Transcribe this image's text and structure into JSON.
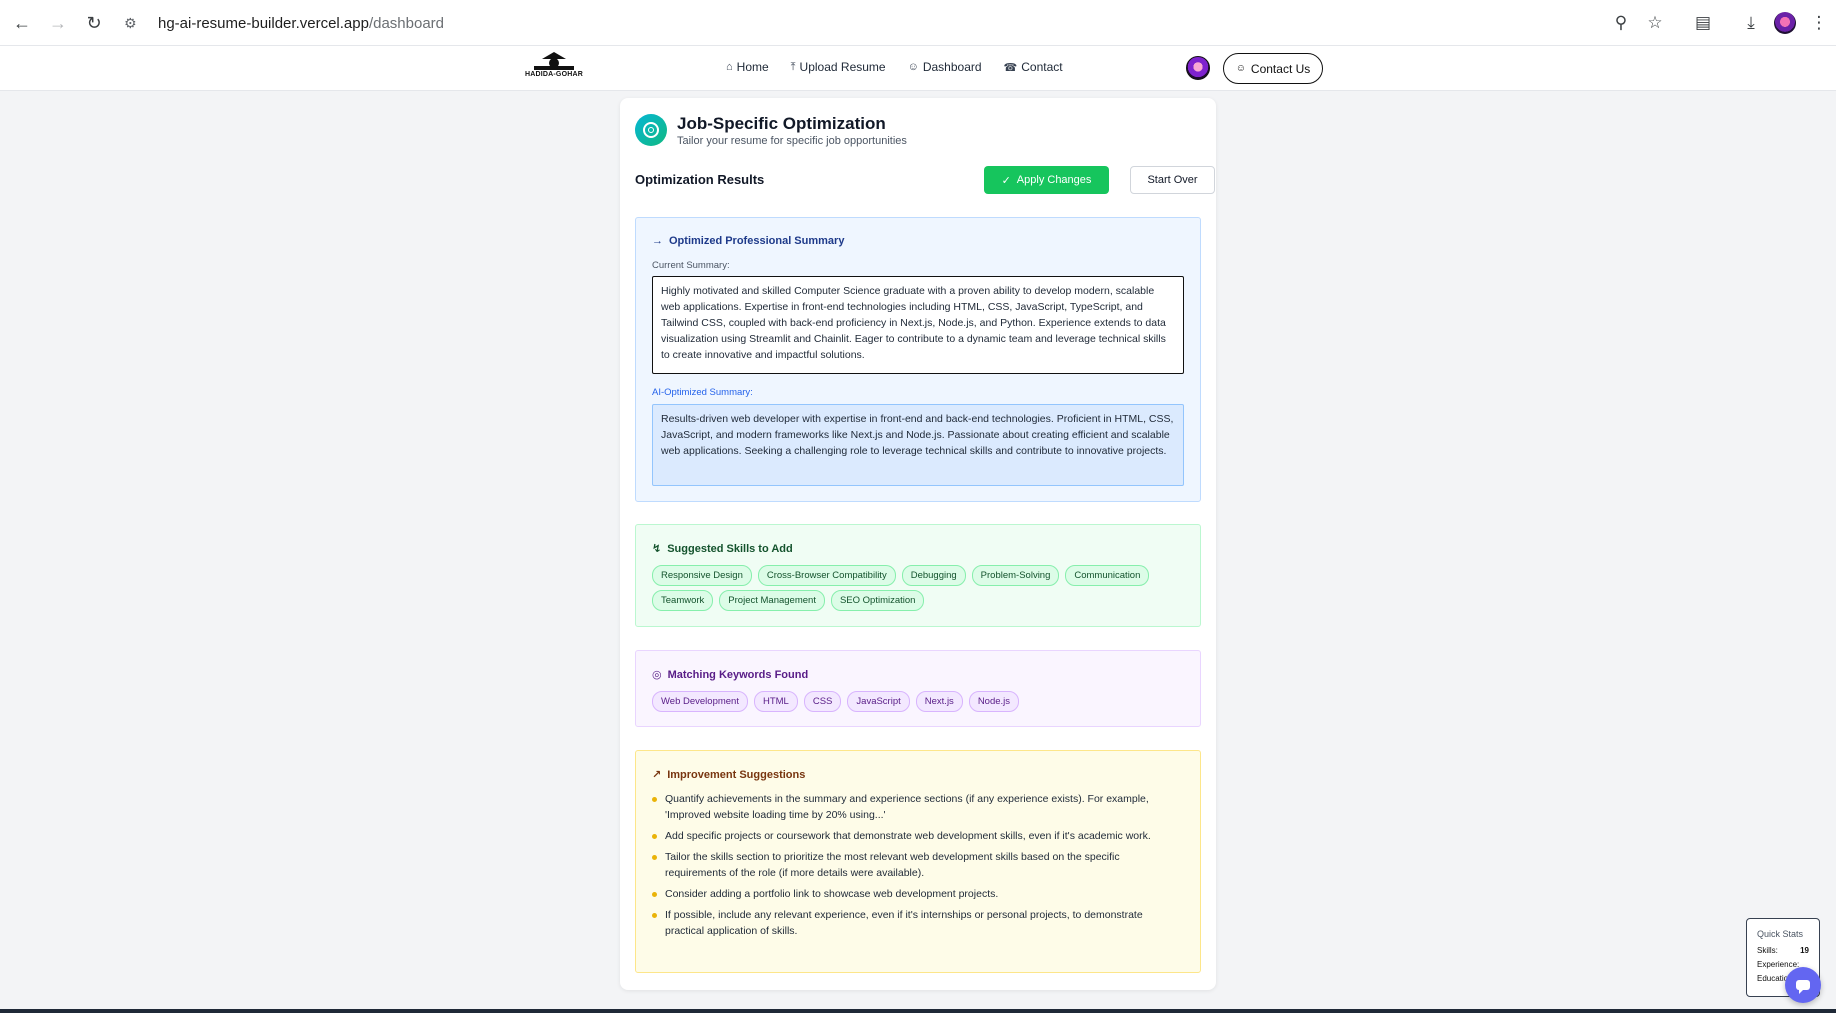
{
  "browser": {
    "url_host": "hg-ai-resume-builder.vercel.app",
    "url_path": "/dashboard"
  },
  "header": {
    "logo_text": "HADIDA-GOHAR",
    "nav": [
      {
        "label": "Home",
        "icon": "home-icon"
      },
      {
        "label": "Upload Resume",
        "icon": "upload-icon"
      },
      {
        "label": "Dashboard",
        "icon": "user-icon"
      },
      {
        "label": "Contact",
        "icon": "phone-icon"
      }
    ],
    "contact_button": "Contact Us"
  },
  "card": {
    "title": "Job-Specific Optimization",
    "subtitle": "Tailor your resume for specific job opportunities",
    "results_title": "Optimization Results",
    "apply_label": "Apply Changes",
    "start_over_label": "Start Over"
  },
  "summary": {
    "title": "Optimized Professional Summary",
    "current_label": "Current Summary:",
    "current_text": "Highly motivated and skilled Computer Science graduate with a proven ability to develop modern, scalable web applications. Expertise in front-end technologies including HTML, CSS, JavaScript, TypeScript, and Tailwind CSS, coupled with back-end proficiency in Next.js, Node.js, and Python. Experience extends to data visualization using Streamlit and Chainlit. Eager to contribute to a dynamic team and leverage technical skills to create innovative and impactful solutions.",
    "ai_label": "AI-Optimized Summary:",
    "ai_text": "Results-driven web developer with expertise in front-end and back-end technologies. Proficient in HTML, CSS, JavaScript, and modern frameworks like Next.js and Node.js. Passionate about creating efficient and scalable web applications. Seeking a challenging role to leverage technical skills and contribute to innovative projects."
  },
  "skills": {
    "title": "Suggested Skills to Add",
    "items": [
      "Responsive Design",
      "Cross-Browser Compatibility",
      "Debugging",
      "Problem-Solving",
      "Communication",
      "Teamwork",
      "Project Management",
      "SEO Optimization"
    ]
  },
  "keywords": {
    "title": "Matching Keywords Found",
    "items": [
      "Web Development",
      "HTML",
      "CSS",
      "JavaScript",
      "Next.js",
      "Node.js"
    ]
  },
  "improvements": {
    "title": "Improvement Suggestions",
    "items": [
      "Quantify achievements in the summary and experience sections (if any experience exists). For example, 'Improved website loading time by 20% using...'",
      "Add specific projects or coursework that demonstrate web development skills, even if it's academic work.",
      "Tailor the skills section to prioritize the most relevant web development skills based on the specific requirements of the role (if more details were available).",
      "Consider adding a portfolio link to showcase web development projects.",
      "If possible, include any relevant experience, even if it's internships or personal projects, to demonstrate practical application of skills."
    ]
  },
  "quick_stats": {
    "title": "Quick Stats",
    "skills_label": "Skills:",
    "skills_value": "19",
    "experience_label": "Experience:",
    "education_label": "Education:"
  },
  "colors": {
    "apply_green": "#16c55d",
    "summary_blue": "#eff6ff",
    "skills_green": "#f0fdf4",
    "keywords_purple": "#faf5ff",
    "improve_yellow": "#fefce8"
  }
}
